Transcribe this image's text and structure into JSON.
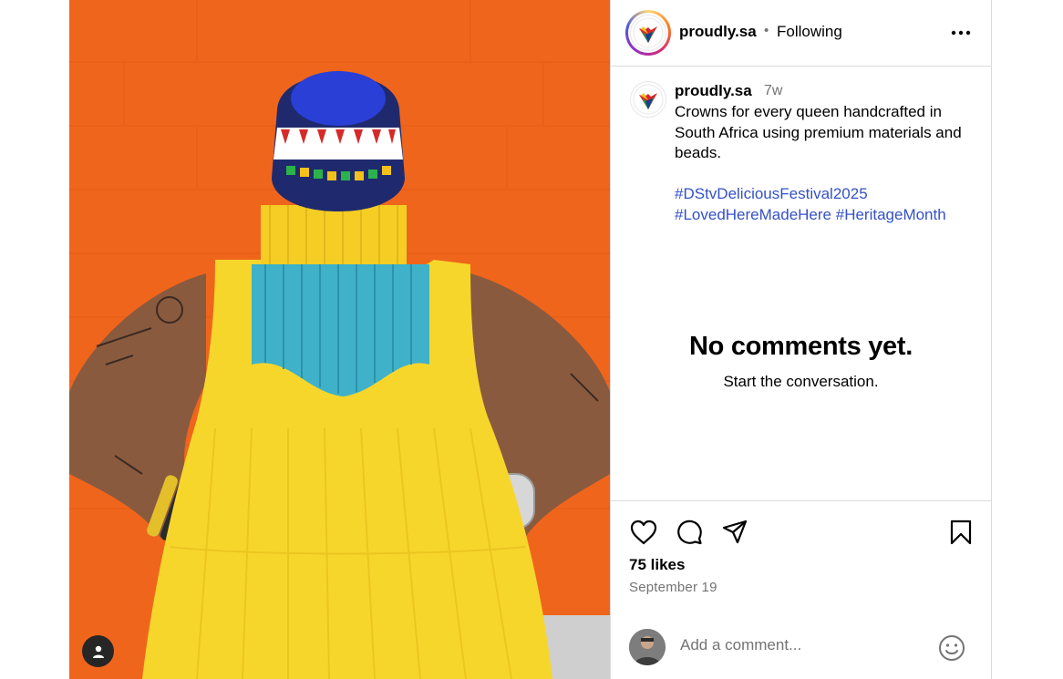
{
  "post": {
    "username": "proudly.sa",
    "follow_status": "Following",
    "separator": "•",
    "more_icon": "more-horizontal-icon",
    "caption": {
      "username": "proudly.sa",
      "time_ago": "7w",
      "text": "Crowns for every queen handcrafted in South Africa using premium materials and beads.",
      "hashtags": [
        "#DStvDeliciousFestival2025",
        "#LovedHereMadeHere",
        "#HeritageMonth"
      ]
    },
    "comments": {
      "empty_title": "No comments yet.",
      "empty_subtitle": "Start the conversation."
    },
    "actions": {
      "like_icon": "heart-icon",
      "comment_icon": "comment-icon",
      "share_icon": "send-icon",
      "save_icon": "bookmark-icon"
    },
    "likes": "75 likes",
    "date": "September 19",
    "comment_box": {
      "placeholder": "Add a comment...",
      "emoji_icon": "emoji-icon"
    }
  },
  "colors": {
    "background": "#f0651c",
    "dress": "#f7d62c",
    "link": "#3451c6",
    "muted": "#737373",
    "border": "#dbdbdb"
  }
}
